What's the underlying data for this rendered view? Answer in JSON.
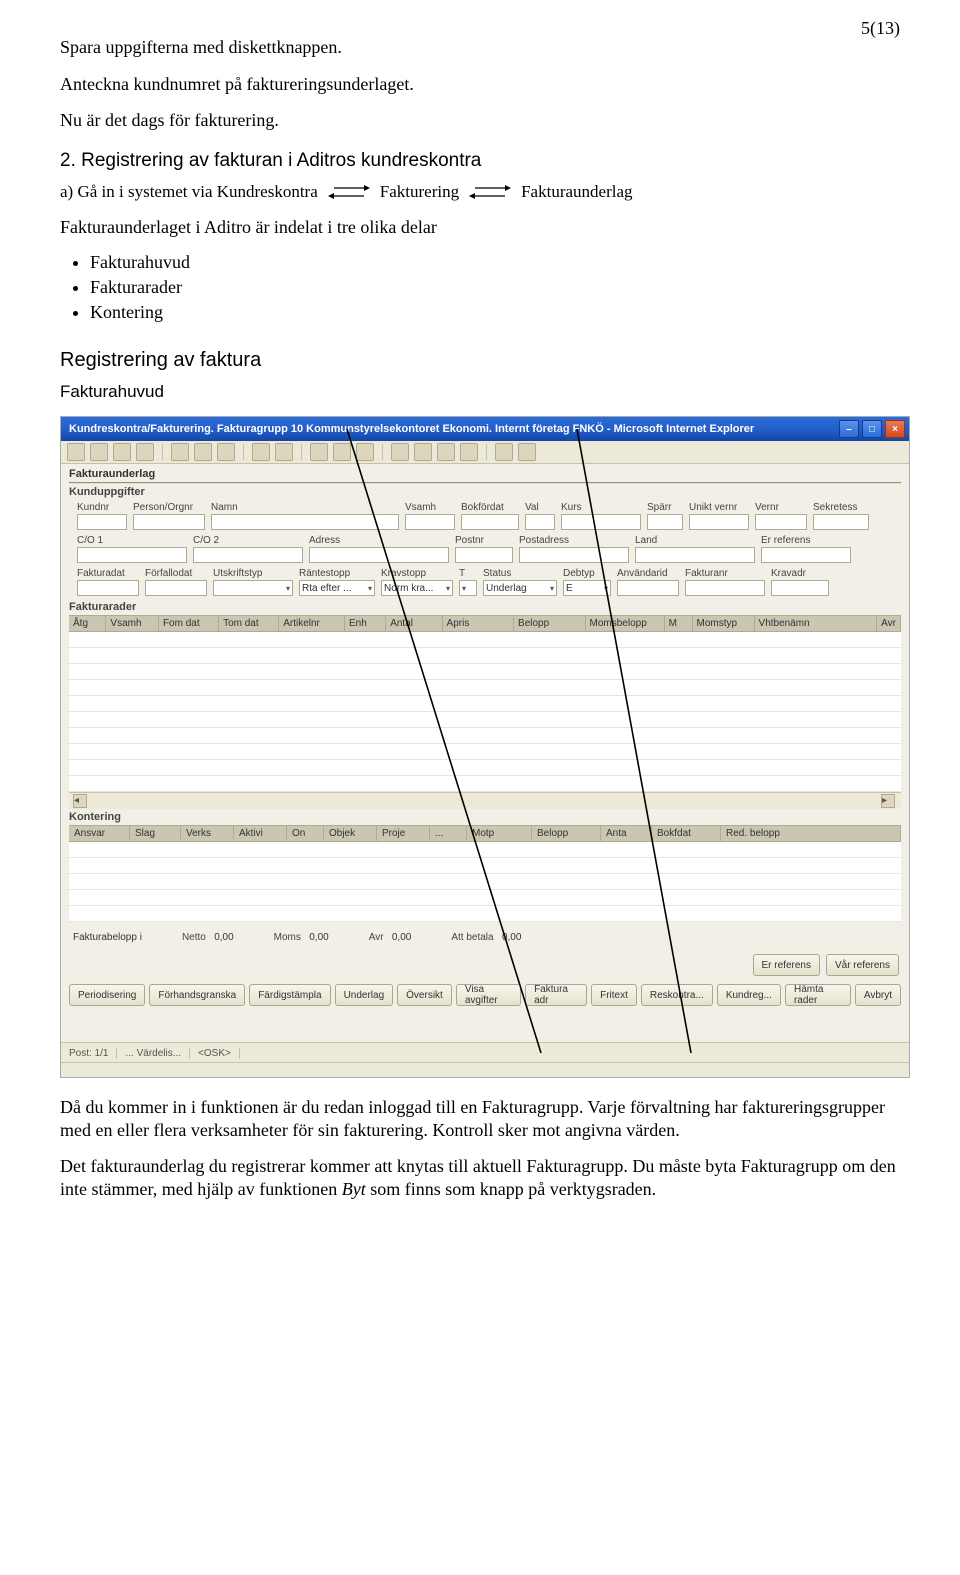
{
  "page_number": "5(13)",
  "p1": "Spara uppgifterna med diskettknappen.",
  "p2": "Anteckna kundnumret på faktureringsunderlaget.",
  "p3": "Nu är det dags för fakturering.",
  "h_sec2": "2. Registrering av fakturan i Aditros kundreskontra",
  "arrow": {
    "lead": "a) Gå in i systemet via Kundreskontra",
    "mid": "Fakturering",
    "end": "Fakturaunderlag"
  },
  "p4": "Fakturaunderlaget i Aditro är indelat i tre olika delar",
  "bullets": [
    "Fakturahuvud",
    "Fakturarader",
    "Kontering"
  ],
  "h_reg": "Registrering av faktura",
  "h_fakturahuvud": "Fakturahuvud",
  "p_after1": "Då du kommer in i funktionen är du redan inloggad till en Fakturagrupp. Varje förvaltning har faktureringsgrupper med en eller flera verksamheter för sin fakturering. Kontroll sker mot angivna värden.",
  "p_after2a": "Det fakturaunderlag du registrerar kommer att knytas till aktuell Fakturagrupp. Du måste byta Fakturagrupp om den inte stämmer, med hjälp av funktionen ",
  "p_after2b": "Byt",
  "p_after2c": " som finns som knapp på verktygsraden.",
  "shot": {
    "title": "Kundreskontra/Fakturering. Fakturagrupp 10 Kommunstyrelsekontoret Ekonomi. Internt företag FNKÖ - Microsoft Internet Explorer",
    "sec_fu": "Fakturaunderlag",
    "sec_kund": "Kunduppgifter",
    "row1_lbl": [
      "Kundnr",
      "Person/Orgnr",
      "Namn",
      "Vsamh",
      "Bokfördat",
      "Val",
      "Kurs",
      "Spärr",
      "Unikt vernr",
      "Vernr",
      "Sekretess"
    ],
    "row2_lbl": [
      "C/O 1",
      "C/O 2",
      "Adress",
      "Postnr",
      "Postadress",
      "Land",
      "Er referens"
    ],
    "row3_lbl": [
      "Fakturadat",
      "Förfallodat",
      "Utskriftstyp",
      "Räntestopp",
      "Kravstopp",
      "T",
      "Status",
      "Debtyp",
      "Användarid",
      "Fakturanr",
      "Kravadr"
    ],
    "row3_dd": [
      "Rta efter ...",
      "Norm kra...",
      "Underlag",
      "E"
    ],
    "sec_rader": "Fakturarader",
    "grid1_head": [
      "Åtg",
      "Vsamh",
      "Fom dat",
      "Tom dat",
      "Artikelnr",
      "Enh",
      "Antal",
      "Apris",
      "Belopp",
      "Momsbelopp",
      "M",
      "Momstyp",
      "Vhtbenämn",
      "Avr"
    ],
    "sec_kont": "Kontering",
    "kont_head": [
      "Ansvar",
      "Slag",
      "Verks",
      "Aktivi",
      "On",
      "Objek",
      "Proje",
      "...",
      "Motp",
      "Belopp",
      "Anta",
      "Bokfdat",
      "Red. belopp"
    ],
    "totals": {
      "lbl1": "Fakturabelopp i",
      "lbl2": "Netto",
      "v2": "0,00",
      "lbl3": "Moms",
      "v3": "0,00",
      "lbl4": "Avr",
      "v4": "0,00",
      "lbl5": "Att betala",
      "v5": "0,00"
    },
    "ref1": "Er referens",
    "ref2": "Vår referens",
    "buttons": [
      "Periodisering",
      "Förhandsgranska",
      "Färdigstämpla",
      "Underlag",
      "Översikt",
      "Visa avgifter",
      "Faktura adr",
      "Fritext",
      "Reskontra...",
      "Kundreg...",
      "Hämta rader",
      "Avbryt"
    ],
    "status": [
      "Post: 1/1",
      "... Värdelis...",
      "<OSK>"
    ]
  }
}
